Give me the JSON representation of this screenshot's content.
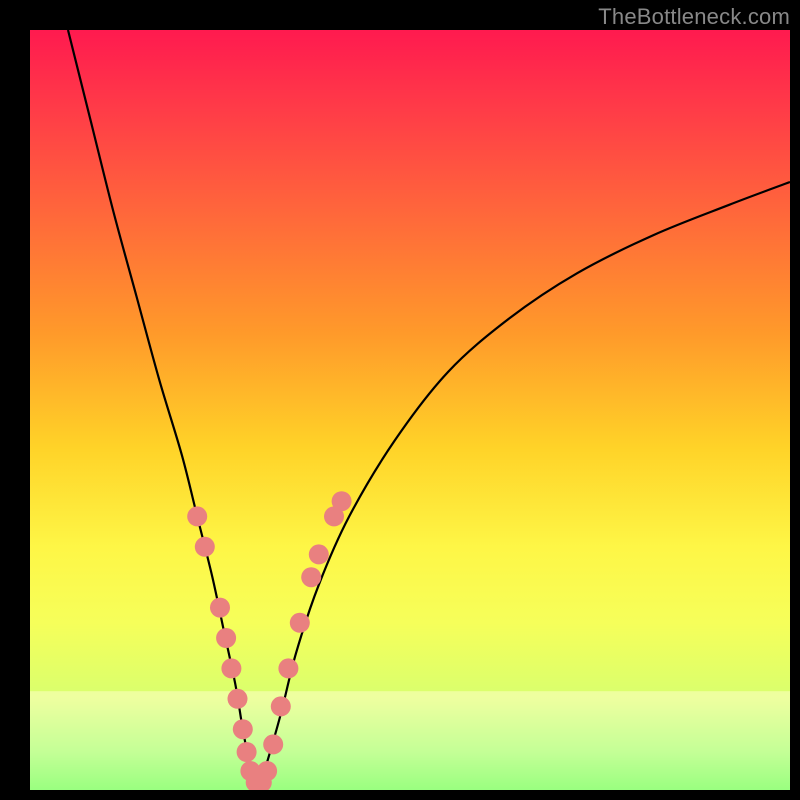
{
  "watermark": "TheBottleneck.com",
  "chart_data": {
    "type": "line",
    "title": "",
    "xlabel": "",
    "ylabel": "",
    "xlim": [
      0,
      100
    ],
    "ylim": [
      0,
      100
    ],
    "series": [
      {
        "name": "bottleneck-curve",
        "color": "#000000",
        "x": [
          5,
          8,
          11,
          14,
          17,
          20,
          22,
          24,
          25.5,
          27,
          28,
          29,
          30,
          31,
          33,
          35,
          38,
          42,
          48,
          55,
          63,
          72,
          82,
          92,
          100
        ],
        "y": [
          100,
          88,
          76,
          65,
          54,
          44,
          36,
          28,
          21,
          14,
          8,
          3,
          0,
          3,
          10,
          18,
          27,
          36,
          46,
          55,
          62,
          68,
          73,
          77,
          80
        ]
      }
    ],
    "markers": {
      "name": "highlight-dots",
      "color": "#e98080",
      "radius": 10,
      "points": [
        {
          "x": 22.0,
          "y": 36
        },
        {
          "x": 23.0,
          "y": 32
        },
        {
          "x": 25.0,
          "y": 24
        },
        {
          "x": 25.8,
          "y": 20
        },
        {
          "x": 26.5,
          "y": 16
        },
        {
          "x": 27.3,
          "y": 12
        },
        {
          "x": 28.0,
          "y": 8
        },
        {
          "x": 28.5,
          "y": 5
        },
        {
          "x": 29.0,
          "y": 2.5
        },
        {
          "x": 29.7,
          "y": 1.0
        },
        {
          "x": 30.5,
          "y": 1.0
        },
        {
          "x": 31.2,
          "y": 2.5
        },
        {
          "x": 32.0,
          "y": 6
        },
        {
          "x": 33.0,
          "y": 11
        },
        {
          "x": 34.0,
          "y": 16
        },
        {
          "x": 35.5,
          "y": 22
        },
        {
          "x": 37.0,
          "y": 28
        },
        {
          "x": 38.0,
          "y": 31
        },
        {
          "x": 40.0,
          "y": 36
        },
        {
          "x": 41.0,
          "y": 38
        }
      ]
    },
    "bottom_band": {
      "y_from": 0,
      "y_to": 13,
      "description": "pale-yellow translucent band near bottom"
    }
  }
}
